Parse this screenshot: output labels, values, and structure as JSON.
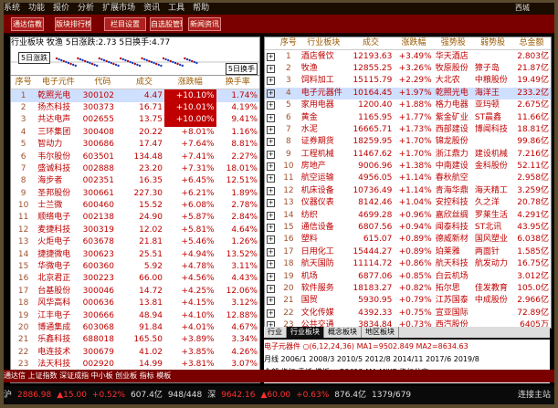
{
  "menu": [
    "系统",
    "功能",
    "报价",
    "分析",
    "扩展市场",
    "资讯",
    "工具",
    "帮助"
  ],
  "window_title": "西城",
  "toolbar": [
    "通达信教",
    "版块排行榜",
    "栏目设置",
    "自选股管理",
    "新闻资讯"
  ],
  "left": {
    "title": "行业板块  牧渔  5日涨跌:2.73  5日换手:4.77",
    "chart_label": "5日涨跌",
    "chart_end": "5日换手",
    "headers": [
      "序号",
      "电子元件",
      "代码",
      "成交",
      "涨跌幅",
      "换手率"
    ],
    "rows": [
      [
        "1",
        "乾照光电",
        "300102",
        "4.47",
        "+10.10%",
        "1.74%"
      ],
      [
        "2",
        "扬杰科技",
        "300373",
        "16.71",
        "+10.01%",
        "4.19%"
      ],
      [
        "3",
        "共达电声",
        "002655",
        "13.75",
        "+10.00%",
        "9.41%"
      ],
      [
        "4",
        "三环集团",
        "300408",
        "20.22",
        "+8.01%",
        "1.16%"
      ],
      [
        "5",
        "智动力",
        "300686",
        "17.47",
        "+7.64%",
        "8.81%"
      ],
      [
        "6",
        "韦尔股份",
        "603501",
        "134.48",
        "+7.41%",
        "2.27%"
      ],
      [
        "7",
        "盛诚科技",
        "002888",
        "23.20",
        "+7.31%",
        "18.01%"
      ],
      [
        "8",
        "海步者",
        "002351",
        "16.35",
        "+6.45%",
        "12.51%"
      ],
      [
        "9",
        "圣邦股份",
        "300661",
        "227.30",
        "+6.21%",
        "1.89%"
      ],
      [
        "10",
        "士兰微",
        "600460",
        "15.52",
        "+6.08%",
        "2.78%"
      ],
      [
        "11",
        "顺络电子",
        "002138",
        "24.90",
        "+5.87%",
        "2.84%"
      ],
      [
        "12",
        "麦捷科技",
        "300319",
        "12.02",
        "+5.81%",
        "4.64%"
      ],
      [
        "13",
        "火炬电子",
        "603678",
        "21.81",
        "+5.46%",
        "1.26%"
      ],
      [
        "14",
        "捷捷微电",
        "300623",
        "25.51",
        "+4.94%",
        "13.52%"
      ],
      [
        "15",
        "华微电子",
        "600360",
        "5.92",
        "+4.78%",
        "3.11%"
      ],
      [
        "16",
        "北京君正",
        "300223",
        "66.00",
        "+4.56%",
        "4.43%"
      ],
      [
        "17",
        "台基股份",
        "300046",
        "14.72",
        "+4.25%",
        "12.06%"
      ],
      [
        "18",
        "风华高科",
        "000636",
        "13.81",
        "+4.15%",
        "3.12%"
      ],
      [
        "19",
        "江丰电子",
        "300666",
        "48.94",
        "+4.10%",
        "12.88%"
      ],
      [
        "20",
        "博通集成",
        "603068",
        "91.84",
        "+4.01%",
        "4.67%"
      ],
      [
        "21",
        "乐鑫科技",
        "688018",
        "165.50",
        "+3.89%",
        "3.34%"
      ],
      [
        "22",
        "电连技术",
        "300679",
        "41.02",
        "+3.85%",
        "4.26%"
      ],
      [
        "23",
        "法天科技",
        "002920",
        "14.99",
        "+3.81%",
        "3.07%"
      ]
    ],
    "tabs": [
      "全部",
      "行业板块",
      "概念板块",
      "地区板块"
    ]
  },
  "right": {
    "headers": [
      "",
      "序号",
      "行业板块",
      "成交",
      "涨跌幅",
      "强势股",
      "弱势股",
      "总金额"
    ],
    "rows": [
      [
        "1",
        "酒店餐饮",
        "12193.63",
        "+3.49%",
        "华天酒店",
        "",
        "2.803亿"
      ],
      [
        "2",
        "牧渔",
        "12855.25",
        "+3.26%",
        "牧原股份",
        "獐子岛",
        "21.87亿"
      ],
      [
        "3",
        "饲料加工",
        "15115.79",
        "+2.29%",
        "大北农",
        "中粮股份",
        "19.49亿"
      ],
      [
        "4",
        "电子元器件",
        "10164.45",
        "+1.97%",
        "乾照光电",
        "海洋王",
        "233.2亿"
      ],
      [
        "5",
        "家用电器",
        "1200.40",
        "+1.88%",
        "格力电器",
        "亚玛顿",
        "2.675亿"
      ],
      [
        "6",
        "黄金",
        "1165.95",
        "+1.77%",
        "紫金矿业",
        "ST晨鑫",
        "11.66亿"
      ],
      [
        "7",
        "水泥",
        "16665.71",
        "+1.73%",
        "西部建设",
        "博闻科技",
        "18.81亿"
      ],
      [
        "8",
        "证券期货",
        "18259.95",
        "+1.70%",
        "锦龙股份",
        "",
        "99.86亿"
      ],
      [
        "9",
        "工程机械",
        "11467.62",
        "+1.70%",
        "浙江鼎力",
        "建设机械",
        "7.216亿"
      ],
      [
        "10",
        "房地产",
        "9006.96",
        "+1.38%",
        "中南建设",
        "金科股份",
        "52.11亿"
      ],
      [
        "11",
        "航空运输",
        "4956.05",
        "+1.14%",
        "春秋航空",
        "",
        "2.958亿"
      ],
      [
        "12",
        "机床设备",
        "10736.49",
        "+1.14%",
        "青海华鼎",
        "海天精工",
        "3.259亿"
      ],
      [
        "13",
        "仪器仪表",
        "8142.46",
        "+1.04%",
        "安控科技",
        "久之洋",
        "20.78亿"
      ],
      [
        "14",
        "纺织",
        "4699.28",
        "+0.96%",
        "嘉欣丝绸",
        "罗莱生活",
        "4.291亿"
      ],
      [
        "15",
        "通信设备",
        "6807.56",
        "+0.94%",
        "闻泰科技",
        "ST北讯",
        "43.95亿"
      ],
      [
        "16",
        "塑料",
        "615.07",
        "+0.89%",
        "德威新材",
        "国风塑业",
        "6.038亿"
      ],
      [
        "17",
        "日用化工",
        "15444.27",
        "+0.89%",
        "珀莱雅",
        "两面针",
        "1.585亿"
      ],
      [
        "18",
        "航天国防",
        "11114.72",
        "+0.86%",
        "航天科技",
        "航发动力",
        "16.75亿"
      ],
      [
        "19",
        "机场",
        "6877.06",
        "+0.85%",
        "白云机场",
        "",
        "3.012亿"
      ],
      [
        "20",
        "软件服务",
        "18183.27",
        "+0.82%",
        "拓尔思",
        "佳发教育",
        "105.0亿"
      ],
      [
        "21",
        "国贸",
        "5930.95",
        "+0.79%",
        "江苏国泰",
        "中成股份",
        "2.966亿"
      ],
      [
        "22",
        "文化传媒",
        "4392.33",
        "+0.75%",
        "宣亚国际",
        "",
        "72.89亿"
      ],
      [
        "23",
        "公共交通",
        "3834.84",
        "+0.73%",
        "西汽股份",
        "",
        "6405万"
      ]
    ],
    "tabs": [
      "行业",
      "行业板块",
      "概念板块",
      "地区板块"
    ],
    "info_rows": [
      "电子元器件  ○(6,12,24,36)  MA1=9502.849  MA2=8634.63",
      "月线  2006/1  2008/3  2010/5  2012/8  2014/11  2017/6  2019/8",
      "全部  指标  委托  模板  ▲  B3612  MA  MIKE  指标分享"
    ]
  },
  "cmdbar": "通达信  上证指数  深证成指  中小板  创业板  指标  模板",
  "ticker": [
    {
      "t": "沪",
      "c": ""
    },
    {
      "t": "2886.98",
      "c": "up"
    },
    {
      "t": "▲15.00",
      "c": "up"
    },
    {
      "t": "+0.52%",
      "c": "up"
    },
    {
      "t": "607.4亿",
      "c": ""
    },
    {
      "t": "948/448",
      "c": ""
    },
    {
      "t": "深",
      "c": ""
    },
    {
      "t": "9642.16",
      "c": "up"
    },
    {
      "t": "▲60.00",
      "c": "up"
    },
    {
      "t": "+0.63%",
      "c": "up"
    },
    {
      "t": "876.4亿",
      "c": ""
    },
    {
      "t": "1379/679",
      "c": ""
    }
  ],
  "stamp": "连接主站"
}
